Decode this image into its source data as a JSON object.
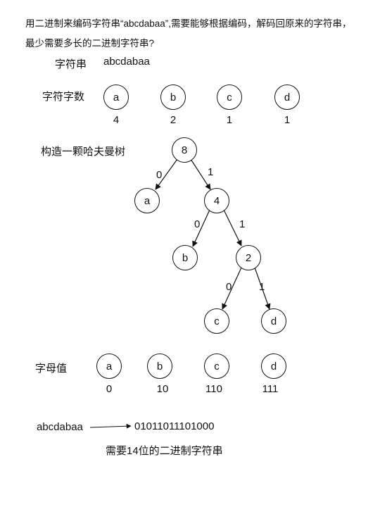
{
  "question": {
    "line1": "用二进制来编码字符串“abcdabaa”,需要能够根据编码，解码回原来的字符串，",
    "line2": "最少需要多长的二进制字符串?"
  },
  "string_row": {
    "label": "字符串",
    "value": "abcdabaa"
  },
  "counts_row": {
    "label": "字符字数",
    "chars": [
      "a",
      "b",
      "c",
      "d"
    ],
    "counts": [
      "4",
      "2",
      "1",
      "1"
    ]
  },
  "tree": {
    "label": "构造一颗哈夫曼树",
    "nodes": {
      "root": "8",
      "a": "a",
      "n4": "4",
      "b": "b",
      "n2": "2",
      "c": "c",
      "d": "d"
    },
    "edge_labels": {
      "root_a": "0",
      "root_n4": "1",
      "n4_b": "0",
      "n4_n2": "1",
      "n2_c": "0",
      "n2_d": "1"
    }
  },
  "codes_row": {
    "label": "字母值",
    "chars": [
      "a",
      "b",
      "c",
      "d"
    ],
    "codes": [
      "0",
      "10",
      "110",
      "111"
    ]
  },
  "encoding": {
    "input": "abcdabaa",
    "output": "01011011101000",
    "conclusion": "需要14位的二进制字符串"
  }
}
